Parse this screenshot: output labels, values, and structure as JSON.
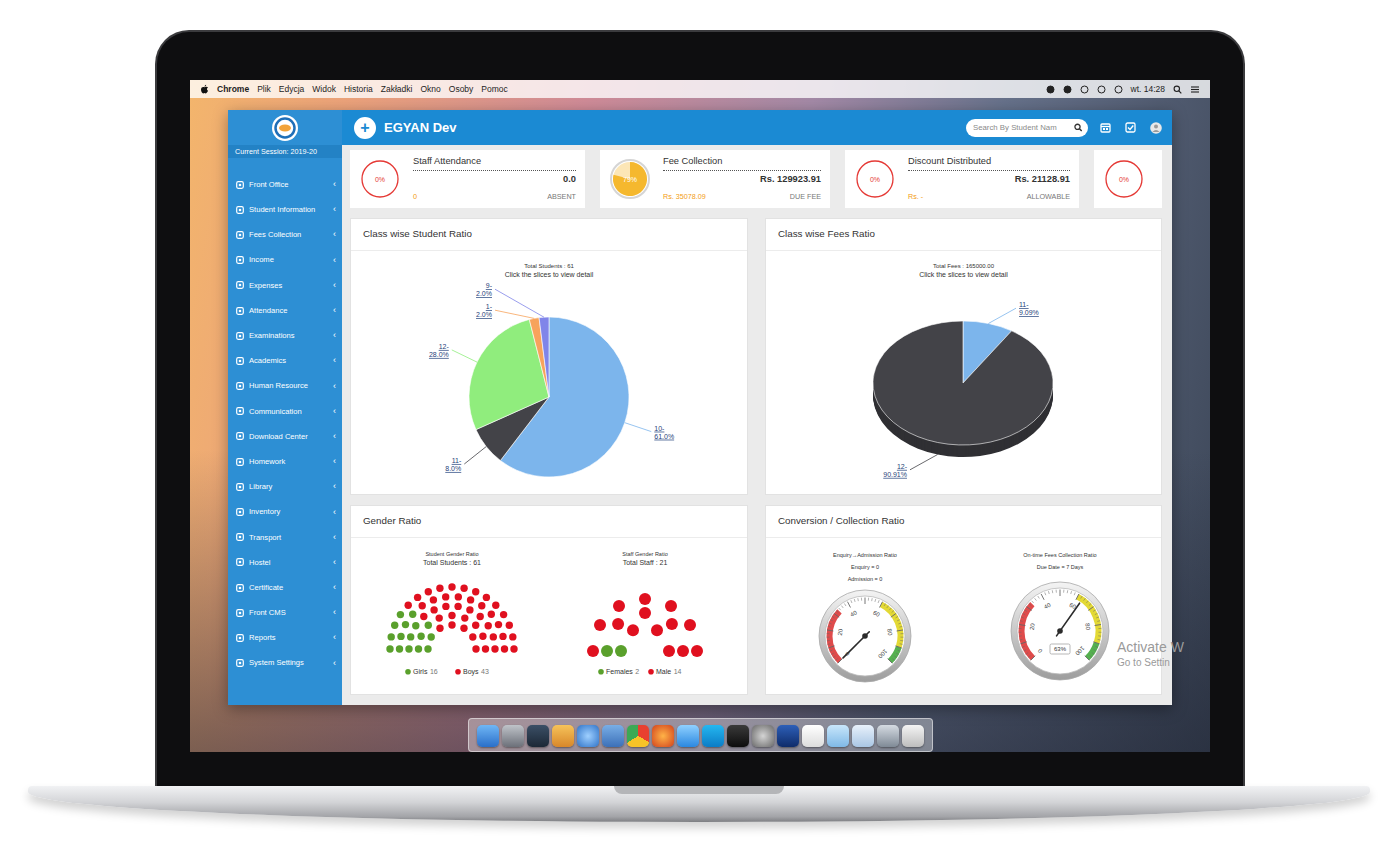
{
  "menubar": {
    "app": "Chrome",
    "menus": [
      "Plik",
      "Edycja",
      "Widok",
      "Historia",
      "Zakładki",
      "Okno",
      "Osoby",
      "Pomoc"
    ],
    "clock": "wt. 14:28"
  },
  "header": {
    "add_button": "+",
    "title": "EGYAN Dev",
    "search": {
      "placeholder": "Search By Student Nam"
    }
  },
  "sidebar": {
    "session": "Current Session: 2019-20",
    "items": [
      {
        "label": "Front Office",
        "arrow": "‹"
      },
      {
        "label": "Student Information",
        "arrow": "‹"
      },
      {
        "label": "Fees Collection",
        "arrow": "‹"
      },
      {
        "label": "Income",
        "arrow": "‹"
      },
      {
        "label": "Expenses",
        "arrow": "‹"
      },
      {
        "label": "Attendance",
        "arrow": "‹"
      },
      {
        "label": "Examinations",
        "arrow": "‹"
      },
      {
        "label": "Academics",
        "arrow": "‹"
      },
      {
        "label": "Human Resource",
        "arrow": "‹"
      },
      {
        "label": "Communication",
        "arrow": "‹"
      },
      {
        "label": "Download Center",
        "arrow": "‹"
      },
      {
        "label": "Homework",
        "arrow": "‹"
      },
      {
        "label": "Library",
        "arrow": "‹"
      },
      {
        "label": "Inventory",
        "arrow": "‹"
      },
      {
        "label": "Transport",
        "arrow": "‹"
      },
      {
        "label": "Hostel",
        "arrow": "‹"
      },
      {
        "label": "Certificate",
        "arrow": "‹"
      },
      {
        "label": "Front CMS",
        "arrow": "‹"
      },
      {
        "label": "Reports",
        "arrow": "‹"
      },
      {
        "label": "System Settings",
        "arrow": "‹"
      }
    ]
  },
  "stats": [
    {
      "title": "Staff Attendance",
      "percent": "0%",
      "level": 0,
      "color": "#e53935",
      "value": "0.0",
      "sub_value": "0",
      "sub_label": "ABSENT"
    },
    {
      "title": "Fee Collection",
      "percent": "79%",
      "level": 0.79,
      "color": "#f5b82e",
      "value": "Rs. 129923.91",
      "sub_value": "Rs. 35078.09",
      "sub_label": "DUE FEE"
    },
    {
      "title": "Discount Distributed",
      "percent": "0%",
      "level": 0,
      "color": "#e53935",
      "value": "Rs. 21128.91",
      "sub_value": "Rs. -",
      "sub_label": "ALLOWABLE"
    },
    {
      "percent": "0%",
      "level": 0,
      "color": "#e53935"
    }
  ],
  "class_students": {
    "title": "Class wise Student Ratio",
    "total": "Total Students : 61",
    "hint": "Click the slices to view detail",
    "slices": [
      {
        "label": "10-",
        "percent": "61.0%",
        "value": 61,
        "color": "#7cb5ec"
      },
      {
        "label": "11-",
        "percent": "8.0%",
        "value": 8,
        "color": "#434348"
      },
      {
        "label": "12-",
        "percent": "28.0%",
        "value": 28,
        "color": "#90ed7d"
      },
      {
        "label": "1-",
        "percent": "2.0%",
        "value": 2,
        "color": "#f7a35c"
      },
      {
        "label": "9-",
        "percent": "2.0%",
        "value": 2,
        "color": "#8085e9"
      }
    ]
  },
  "class_fees": {
    "title": "Class wise Fees Ratio",
    "total": "Total Fees : 165000.00",
    "hint": "Click the slices to view detail",
    "slices": [
      {
        "label": "11-",
        "percent": "9.09%",
        "value": 9.09,
        "color": "#7cb5ec"
      },
      {
        "label": "12-",
        "percent": "90.91%",
        "value": 90.91,
        "color": "#434348"
      }
    ]
  },
  "gender": {
    "title": "Gender Ratio",
    "charts": [
      {
        "title": "Student Gender Ratio",
        "total": "Total Students : 61",
        "groups": [
          {
            "label": "Girls",
            "count": "16",
            "value": 16,
            "color": "#5aa02c"
          },
          {
            "label": "Boys",
            "count": "43",
            "value": 43,
            "color": "#e0101f"
          }
        ]
      },
      {
        "title": "Staff Gender Ratio",
        "total": "Total Staff : 21",
        "groups": [
          {
            "label": "Females",
            "count": "2",
            "value": 2,
            "color": "#5aa02c"
          },
          {
            "label": "Male",
            "count": "14",
            "value": 14,
            "color": "#e0101f"
          }
        ]
      }
    ]
  },
  "conversion": {
    "title": "Conversion / Collection Ratio",
    "gauges": [
      {
        "title": "Enquiry→Admission Ratio",
        "lines": [
          "Enquiry = 0",
          "Admission = 0"
        ],
        "ticks": [
          "0",
          "20",
          "40",
          "60",
          "80",
          "100"
        ],
        "level": 0
      },
      {
        "title": "On-time Fees Collection Ratio",
        "lines": [
          "Due Date = 7 Days"
        ],
        "ticks": [
          "0",
          "20",
          "40",
          "60",
          "80",
          "100"
        ],
        "level": 0.63,
        "reading": "63%"
      }
    ]
  },
  "watermark": {
    "lines": [
      "Activate W",
      "Go to Settin"
    ]
  }
}
